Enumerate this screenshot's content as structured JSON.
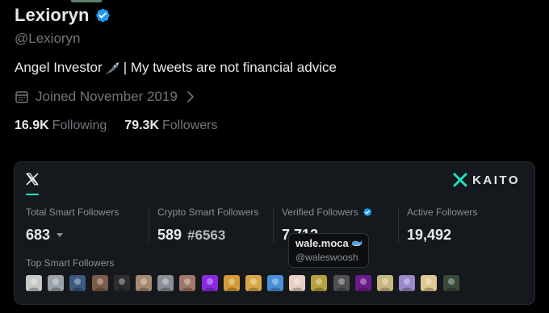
{
  "profile": {
    "display_name": "Lexioryn",
    "handle": "@Lexioryn",
    "bio_prefix": "Angel Investor",
    "bio_suffix": "| My tweets are not financial advice",
    "joined": "Joined November 2019",
    "following_count": "16.9K",
    "following_label": "Following",
    "followers_count": "79.3K",
    "followers_label": "Followers"
  },
  "kaito": {
    "brand": "KAITO",
    "tab": "X",
    "metrics": [
      {
        "label": "Total Smart Followers",
        "value": "683"
      },
      {
        "label": "Crypto Smart Followers",
        "value": "589",
        "rank": "#6563"
      },
      {
        "label": "Verified Followers",
        "value": "7,712"
      },
      {
        "label": "Active Followers",
        "value": "19,492"
      }
    ],
    "top_smart_label": "Top Smart Followers",
    "tooltip": {
      "name": "wale.moca",
      "handle": "@waleswoosh"
    },
    "avatar_colors": [
      "#c8c8c8",
      "#9ca3a8",
      "#3d5a80",
      "#7a5c48",
      "#2d2d2d",
      "#a88b6e",
      "#8a8f96",
      "#a07868",
      "#8a2be2",
      "#d49a3a",
      "#d8a848",
      "#4a90d9",
      "#e8d0c0",
      "#b8a040",
      "#505050",
      "#6a1a8a",
      "#c8b880",
      "#9a88c8",
      "#e0c890",
      "#3a4a3a"
    ]
  },
  "colors": {
    "verified_blue": "#1d9bf0",
    "accent_teal": "#22e0c4"
  }
}
